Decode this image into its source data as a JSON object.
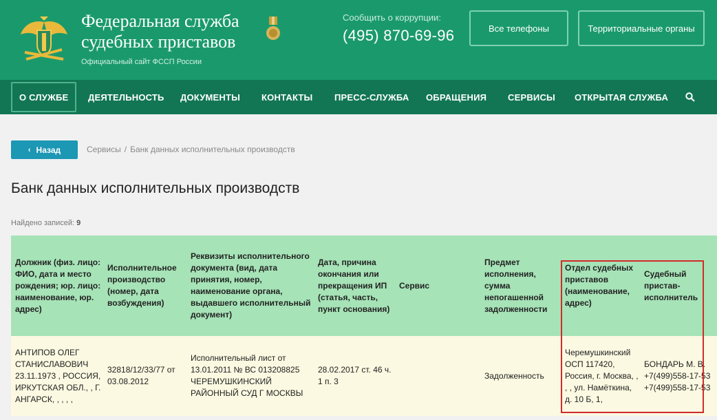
{
  "header": {
    "title_line1": "Федеральная служба",
    "title_line2": "судебных приставов",
    "subtitle": "Официальный сайт ФССП России",
    "corruption_label": "Сообщить о коррупции:",
    "corruption_phone": "(495) 870-69-96",
    "btn_all_phones": "Все телефоны",
    "btn_territorial": "Территориальные органы",
    "colors": {
      "header_bg": "#1a9a6c",
      "nav_bg": "#127654"
    }
  },
  "nav": {
    "items": [
      "О СЛУЖБЕ",
      "ДЕЯТЕЛЬНОСТЬ",
      "ДОКУМЕНТЫ",
      "КОНТАКТЫ",
      "ПРЕСС-СЛУЖБА",
      "ОБРАЩЕНИЯ",
      "СЕРВИСЫ",
      "ОТКРЫТАЯ СЛУЖБА"
    ],
    "active": "О СЛУЖБЕ",
    "search_icon": "search-icon"
  },
  "content": {
    "back_label": "Назад",
    "breadcrumb": [
      "Сервисы",
      "Банк данных исполнительных производств"
    ],
    "breadcrumb_sep": "/",
    "page_title": "Банк данных исполнительных производств",
    "found_label": "Найдено записей:",
    "found_count": "9"
  },
  "table": {
    "headers": [
      "Должник (физ. лицо: ФИО, дата и место рождения; юр. лицо: наименование, юр. адрес)",
      "Исполнительное производство (номер, дата возбуждения)",
      "Реквизиты исполнительного документа (вид, дата принятия, номер, наименование органа, выдавшего исполнительный документ)",
      "Дата, причина окончания или прекращения ИП (статья, часть, пункт основания)",
      "Сервис",
      "Предмет исполнения, сумма непогашенной задолженности",
      "Отдел судебных приставов (наименование, адрес)",
      "Судебный пристав-исполнитель"
    ],
    "row": [
      "АНТИПОВ ОЛЕГ СТАНИСЛАВОВИЧ 23.11.1973 , РОССИЯ, ИРКУТСКАЯ ОБЛ., , Г. АНГАРСК, , , , ,",
      "32818/12/33/77 от 03.08.2012",
      "Исполнительный лист от 13.01.2011 № ВС 013208825 ЧЕРЕМУШКИНСКИЙ РАЙОННЫЙ СУД Г МОСКВЫ",
      "28.02.2017 ст. 46 ч. 1 п. 3",
      "",
      "Задолженность",
      "Черемушкинский ОСП 117420, Россия, г. Москва, , , , ул. Намёткина, д. 10 Б, 1,",
      "БОНДАРЬ М. В. +7(499)558-17-53 +7(499)558-17-53"
    ]
  }
}
